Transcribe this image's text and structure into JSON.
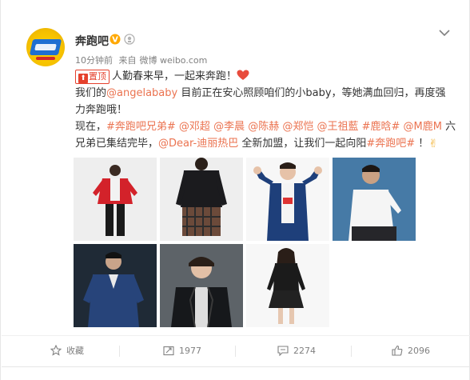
{
  "post": {
    "username": "奔跑吧",
    "verified_icon": "verified-badge-icon",
    "member_icon": "member-icon",
    "time": "10分钟前",
    "source_prefix": "来自",
    "source": "微博 weibo.com",
    "menu_icon": "chevron-down-icon"
  },
  "content": {
    "pin_label": "置顶",
    "line1": "人勤春来早，一起来奔跑！",
    "line2_prefix": "我们的",
    "mention_angelababy": "@angelababy",
    "line2_suffix": " 目前正在安心照顾咱们的小baby，等她满血回归，再度强",
    "line3": "力奔跑哦！",
    "line4_prefix": "现在，",
    "line4_links": "#奔跑吧兄弟# @邓超 @李晨 @陈赫 @郑恺 @王祖藍 #鹿晗# @M鹿M",
    "line4_suffix": " 六",
    "line5_prefix": "兄弟已集结完毕，",
    "mention_dilireba": "@Dear-迪丽热巴",
    "line5_mid": " 全新加盟，让我们一起向阳",
    "hashtag_run": "#奔跑吧#",
    "line5_end": " ！",
    "emoji_heart": "heart-emoji",
    "emoji_victory": "victory-hand-emoji"
  },
  "photos": [
    {
      "name": "photo-red-jacket"
    },
    {
      "name": "photo-black-sweater-plaid"
    },
    {
      "name": "photo-blue-jacket-hands"
    },
    {
      "name": "photo-white-shirt"
    },
    {
      "name": "photo-blue-suit"
    },
    {
      "name": "photo-leather-jacket"
    },
    {
      "name": "photo-black-dress"
    }
  ],
  "actions": {
    "favorite": "收藏",
    "repost": "1977",
    "comment": "2274",
    "like": "2096"
  },
  "colors": {
    "link": "#eb7350",
    "pin": "#e5412d",
    "text": "#333333",
    "meta": "#808080",
    "verified": "#ffa800"
  }
}
